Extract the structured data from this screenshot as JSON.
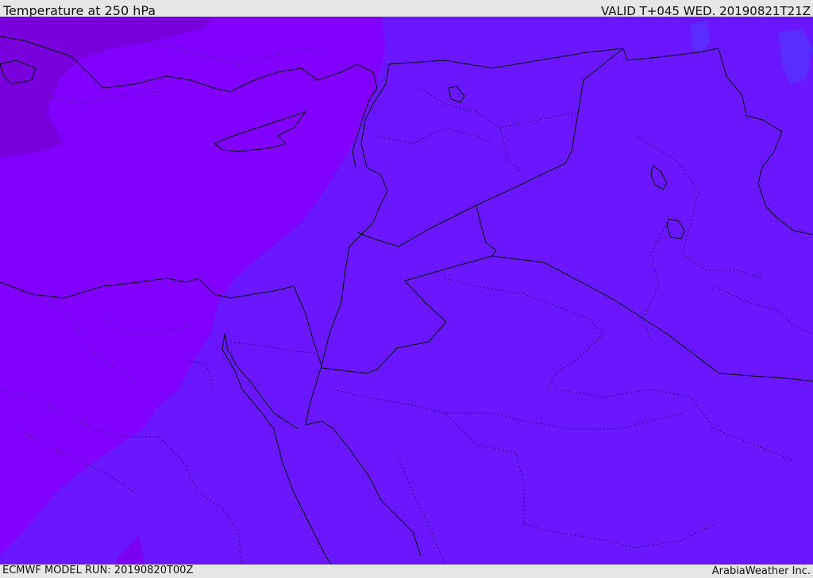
{
  "header": {
    "title": "Temperature at 250 hPa",
    "valid": "VALID T+045 WED. 20190821T21Z"
  },
  "footer": {
    "model_run": "ECMWF MODEL RUN: 20190820T00Z",
    "credit": "ArabiaWeather Inc."
  },
  "map": {
    "variable": "Temperature",
    "level": "250 hPa",
    "colors": {
      "dark_purple": "#7a00e0",
      "violet": "#8200ff",
      "blue_violet": "#6a17ff",
      "light_blue_violet": "#5b26ff",
      "border": "#000000"
    }
  }
}
